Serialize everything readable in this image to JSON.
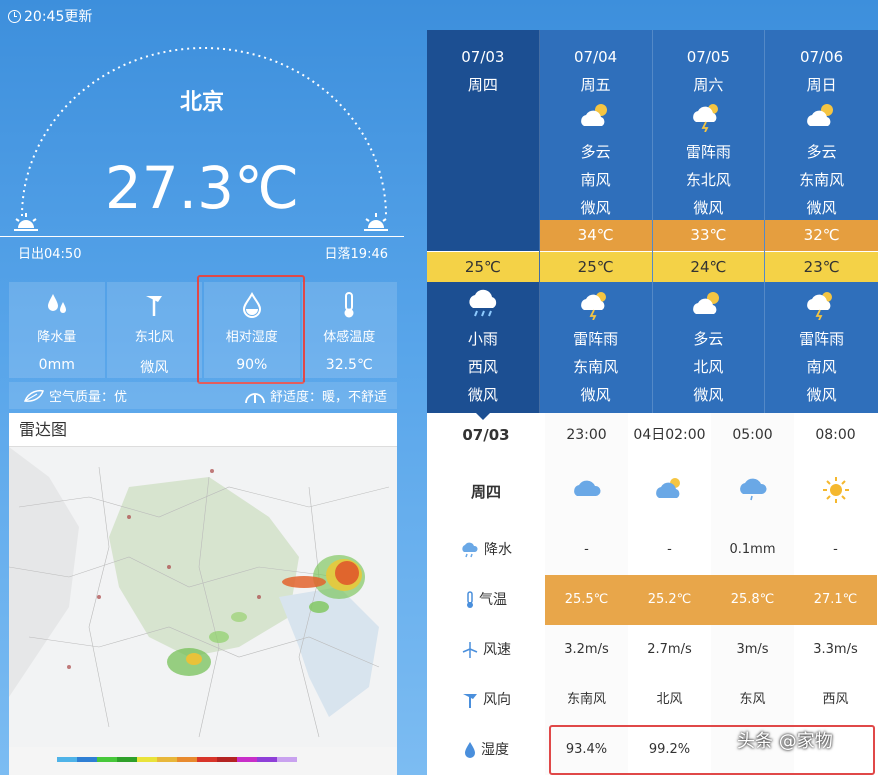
{
  "update_time": "20:45更新",
  "city": "北京",
  "temperature": "27.3℃",
  "sunrise": "日出04:50",
  "sunset": "日落19:46",
  "stats": [
    {
      "label": "降水量",
      "value": "0mm",
      "icon": "raindrops-icon"
    },
    {
      "label": "东北风",
      "value": "微风",
      "icon": "wind-icon"
    },
    {
      "label": "相对湿度",
      "value": "90%",
      "icon": "humidity-drop-icon"
    },
    {
      "label": "体感温度",
      "value": "32.5℃",
      "icon": "thermometer-icon"
    }
  ],
  "air_quality": "空气质量：优",
  "comfort": "舒适度：暖，不舒适",
  "radar_title": "雷达图",
  "days": [
    {
      "date": "07/03",
      "weekday": "周四",
      "hi": "",
      "lo": "25℃",
      "night_weather": "小雨",
      "night_wind_dir": "西风",
      "night_wind": "微风"
    },
    {
      "date": "07/04",
      "weekday": "周五",
      "day_weather": "多云",
      "day_wind_dir": "南风",
      "day_wind": "微风",
      "hi": "34℃",
      "lo": "25℃",
      "night_weather": "雷阵雨",
      "night_wind_dir": "东南风",
      "night_wind": "微风"
    },
    {
      "date": "07/05",
      "weekday": "周六",
      "day_weather": "雷阵雨",
      "day_wind_dir": "东北风",
      "day_wind": "微风",
      "hi": "33℃",
      "lo": "24℃",
      "night_weather": "多云",
      "night_wind_dir": "北风",
      "night_wind": "微风"
    },
    {
      "date": "07/06",
      "weekday": "周日",
      "day_weather": "多云",
      "day_wind_dir": "东南风",
      "day_wind": "微风",
      "hi": "32℃",
      "lo": "23℃",
      "night_weather": "雷阵雨",
      "night_wind_dir": "南风",
      "night_wind": "微风"
    }
  ],
  "hourly": {
    "date": "07/03",
    "weekday": "周四",
    "times": [
      "23:00",
      "04日02:00",
      "05:00",
      "08:00"
    ],
    "labels": {
      "rain": "降水",
      "temp": "气温",
      "speed": "风速",
      "dir": "风向",
      "humid": "湿度"
    },
    "rain": [
      "-",
      "-",
      "0.1mm",
      "-"
    ],
    "temp": [
      "25.5℃",
      "25.2℃",
      "25.8℃",
      "27.1℃"
    ],
    "speed": [
      "3.2m/s",
      "2.7m/s",
      "3m/s",
      "3.3m/s"
    ],
    "dir": [
      "东南风",
      "北风",
      "东风",
      "西风"
    ],
    "humid": [
      "93.4%",
      "99.2%",
      "",
      ""
    ]
  },
  "watermark": "头条 @家物"
}
